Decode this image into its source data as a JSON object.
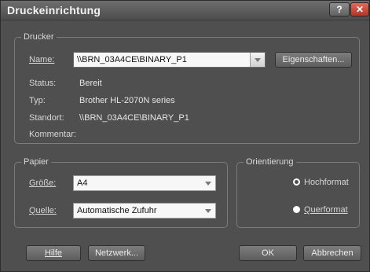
{
  "window": {
    "title": "Druckeinrichtung",
    "help_icon_glyph": "?",
    "close_icon_glyph": "✕",
    "title_font_color": "#f2f2f2",
    "close_color": "#c94b3c"
  },
  "printer": {
    "group_label": "Drucker",
    "name_label": "Name:",
    "name_value": "\\\\BRN_03A4CE\\BINARY_P1",
    "properties_button": "Eigenschaften...",
    "status_label": "Status:",
    "status_value": "Bereit",
    "type_label": "Typ:",
    "type_value": "Brother HL-2070N series",
    "location_label": "Standort:",
    "location_value": "\\\\BRN_03A4CE\\BINARY_P1",
    "comment_label": "Kommentar:",
    "comment_value": ""
  },
  "paper": {
    "group_label": "Papier",
    "size_label": "Größe:",
    "size_value": "A4",
    "source_label": "Quelle:",
    "source_value": "Automatische Zufuhr"
  },
  "orientation": {
    "group_label": "Orientierung",
    "portrait_label": "Hochformat",
    "landscape_label": "Querformat",
    "selected": "Hochformat"
  },
  "footer": {
    "help_button": "Hilfe",
    "network_button": "Netzwerk...",
    "ok_button": "OK",
    "cancel_button": "Abbrechen"
  }
}
